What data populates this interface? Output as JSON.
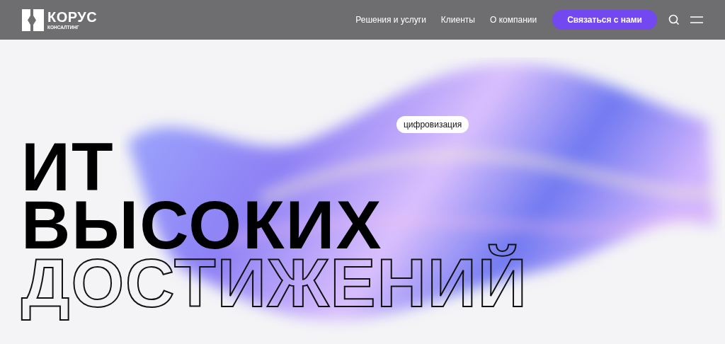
{
  "header": {
    "logo": {
      "name": "КОРУС",
      "subtitle": "КОНСАЛТИНГ"
    },
    "nav": [
      {
        "label": "Решения и услуги"
      },
      {
        "label": "Клиенты"
      },
      {
        "label": "О компании"
      }
    ],
    "cta": "Связаться с нами"
  },
  "hero": {
    "tag": "цифровизация",
    "headline": [
      {
        "text": "ИТ",
        "kind": "solid"
      },
      {
        "text": "ВЫСОКИХ",
        "kind": "solid"
      },
      {
        "text": "ДОСТИЖЕНИЙ",
        "kind": "outline"
      }
    ]
  }
}
